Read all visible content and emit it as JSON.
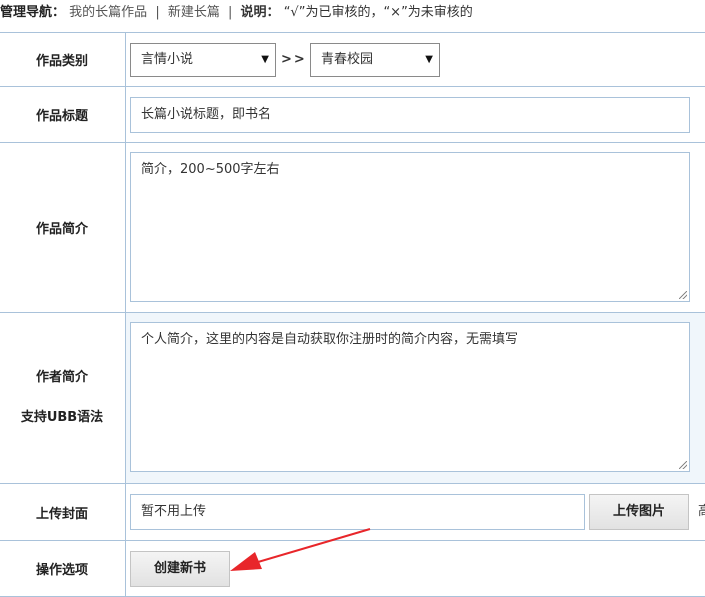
{
  "topnav": {
    "label": "管理导航：",
    "link_my_works": "我的长篇作品",
    "separator": "|",
    "link_new_novel": "新建长篇",
    "note_label": "说明：",
    "note_text": "“√”为已审核的，“×”为未审核的"
  },
  "form": {
    "category": {
      "label": "作品类别",
      "select1_value": "言情小说",
      "arrows": ">>",
      "select2_value": "青春校园"
    },
    "title": {
      "label": "作品标题",
      "value": "长篇小说标题，即书名"
    },
    "synopsis": {
      "label": "作品简介",
      "value": "简介，200~500字左右"
    },
    "author_bio": {
      "label_line1": "作者简介",
      "label_line2": "支持UBB语法",
      "value": "个人简介，这里的内容是自动获取你注册时的简介内容，无需填写"
    },
    "cover": {
      "label": "上传封面",
      "value": "暂不用上传",
      "upload_button": "上传图片",
      "cutoff_text": "高"
    },
    "actions": {
      "label": "操作选项",
      "create_button": "创建新书"
    }
  },
  "colors": {
    "border": "#a9c2da",
    "alt_row_bg": "#f0f6fb",
    "annotation_arrow": "#e8262a"
  }
}
